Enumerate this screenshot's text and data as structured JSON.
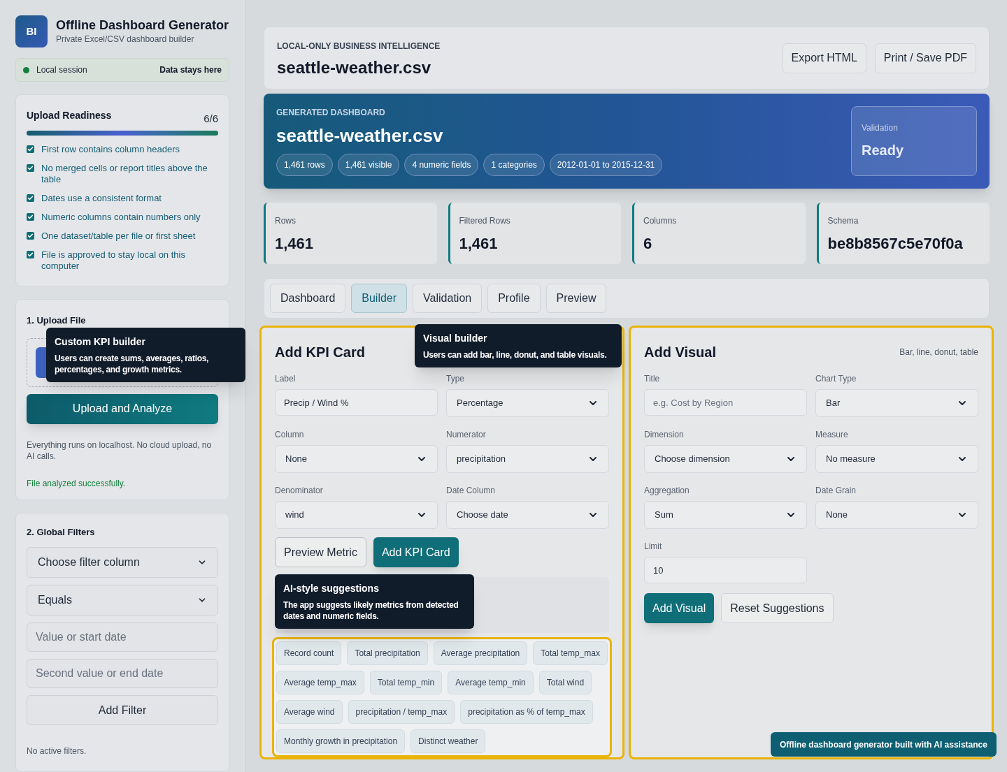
{
  "brand": {
    "logo": "BI",
    "title": "Offline Dashboard Generator",
    "subtitle": "Private Excel/CSV dashboard builder"
  },
  "session": {
    "label": "Local session",
    "note": "Data stays here",
    "color": "#15803d"
  },
  "readiness": {
    "title": "Upload Readiness",
    "count": "6/6",
    "level": 1,
    "items": [
      {
        "label": "First row contains column headers",
        "checked": true
      },
      {
        "label": "No merged cells or report titles above the table",
        "checked": true
      },
      {
        "label": "Dates use a consistent format",
        "checked": true
      },
      {
        "label": "Numeric columns contain numbers only",
        "checked": true
      },
      {
        "label": "One dataset/table per file or first sheet",
        "checked": true
      },
      {
        "label": "File is approved to stay local on this computer",
        "checked": true
      }
    ]
  },
  "upload": {
    "title": "1. Upload File",
    "button": "Upload and Analyze",
    "note": "Everything runs on localhost. No cloud upload, no AI calls.",
    "status": "File analyzed successfully."
  },
  "filters": {
    "title": "2. Global Filters",
    "column_select": "Choose filter column",
    "operator_select": "Equals",
    "value_placeholder": "Value or start date",
    "second_placeholder": "Second value or end date",
    "button": "Add Filter",
    "note": "No active filters."
  },
  "header": {
    "eyebrow": "LOCAL-ONLY BUSINESS INTELLIGENCE",
    "title": "seattle-weather.csv",
    "buttons": [
      "Export HTML",
      "Print / Save PDF"
    ]
  },
  "hero": {
    "eyebrow": "GENERATED DASHBOARD",
    "title": "seattle-weather.csv",
    "pills": [
      "1,461 rows",
      "1,461 visible",
      "4 numeric fields",
      "1 categories",
      "2012-01-01 to 2015-12-31"
    ],
    "status_label": "Validation",
    "status_value": "Ready"
  },
  "stats": [
    {
      "label": "Rows",
      "value": "1,461"
    },
    {
      "label": "Filtered Rows",
      "value": "1,461"
    },
    {
      "label": "Columns",
      "value": "6"
    },
    {
      "label": "Schema",
      "value": "be8b8567c5e70f0a"
    }
  ],
  "tabs": [
    {
      "label": "Dashboard",
      "selected": false
    },
    {
      "label": "Builder",
      "selected": true
    },
    {
      "label": "Validation",
      "selected": false
    },
    {
      "label": "Profile",
      "selected": false
    },
    {
      "label": "Preview",
      "selected": false
    }
  ],
  "kpi": {
    "title": "Add KPI Card",
    "fields": [
      {
        "label": "Label",
        "kind": "input",
        "value": "Precip / Wind %"
      },
      {
        "label": "Type",
        "kind": "select",
        "value": "Percentage"
      },
      {
        "label": "Column",
        "kind": "select",
        "value": "None"
      },
      {
        "label": "Numerator",
        "kind": "select",
        "value": "precipitation"
      },
      {
        "label": "Denominator",
        "kind": "select",
        "value": "wind"
      },
      {
        "label": "Date Column",
        "kind": "select",
        "value": "Choose date"
      }
    ],
    "buttons": [
      "Preview Metric",
      "Add KPI Card"
    ],
    "suggestions": [
      "Record count",
      "Total precipitation",
      "Average precipitation",
      "Total temp_max",
      "Average temp_max",
      "Total temp_min",
      "Average temp_min",
      "Total wind",
      "Average wind",
      "precipitation / temp_max",
      "precipitation as % of temp_max",
      "Monthly growth in precipitation",
      "Distinct weather"
    ]
  },
  "visual": {
    "title": "Add Visual",
    "hint": "Bar, line, donut, table",
    "fields": [
      {
        "label": "Title",
        "kind": "input",
        "placeholder": "e.g. Cost by Region"
      },
      {
        "label": "Chart Type",
        "kind": "select",
        "value": "Bar"
      },
      {
        "label": "Dimension",
        "kind": "select",
        "value": "Choose dimension"
      },
      {
        "label": "Measure",
        "kind": "select",
        "value": "No measure"
      },
      {
        "label": "Aggregation",
        "kind": "select",
        "value": "Sum"
      },
      {
        "label": "Date Grain",
        "kind": "select",
        "value": "None"
      },
      {
        "label": "Limit",
        "kind": "input",
        "value": "10"
      }
    ],
    "buttons": [
      "Add Visual",
      "Reset Suggestions"
    ]
  },
  "tooltips": [
    {
      "title": "Custom KPI builder",
      "text": "Users can create sums, averages, ratios, percentages, and growth metrics."
    },
    {
      "title": "Visual builder",
      "text": "Users can add bar, line, donut, and table visuals."
    },
    {
      "title": "AI-style suggestions",
      "text": "The app suggests likely metrics from detected dates and numeric fields."
    }
  ],
  "footer_badge": "Offline dashboard generator built with AI assistance"
}
